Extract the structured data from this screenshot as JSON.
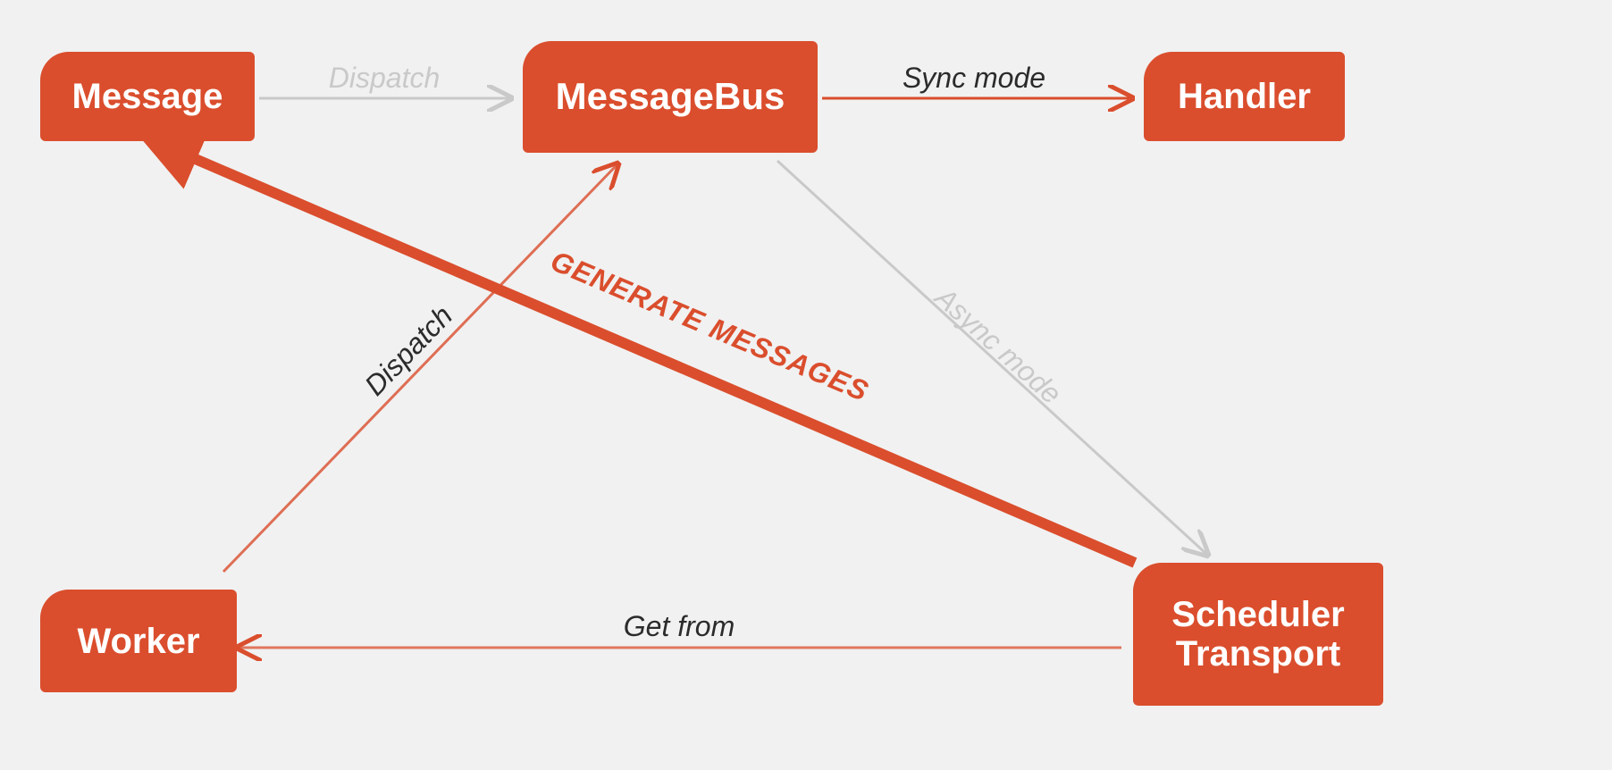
{
  "nodes": {
    "message": {
      "label": "Message"
    },
    "bus": {
      "label": "MessageBus"
    },
    "handler": {
      "label": "Handler"
    },
    "worker": {
      "label": "Worker"
    },
    "transport": {
      "label": "Scheduler\nTransport"
    }
  },
  "edges": {
    "dispatch_top": {
      "label": "Dispatch"
    },
    "sync": {
      "label": "Sync mode"
    },
    "async": {
      "label": "Async mode"
    },
    "getfrom": {
      "label": "Get from"
    },
    "dispatch_worker": {
      "label": "Dispatch"
    },
    "generate": {
      "label": "GENERATE MESSAGES"
    }
  },
  "colors": {
    "accent": "#DA4E2D",
    "faded": "#c9c9c9",
    "text": "#2b2b2b",
    "bg": "#f1f1f1"
  }
}
